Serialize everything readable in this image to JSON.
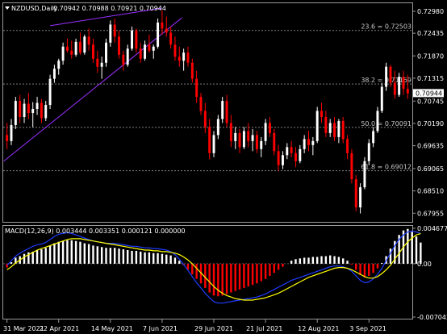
{
  "symbol_header": {
    "symbol": "NZDUSD,Daily",
    "ohlc": "0.70942 0.70988 0.70921 0.70944"
  },
  "macd_header": {
    "label": "MACD(12,26,9) 0.003444 0.003351 0.000121 0.000000"
  },
  "price_axis": {
    "ticks": [
      "0.72980",
      "0.72435",
      "0.71870",
      "0.71315",
      "0.70745",
      "0.70190",
      "0.69635",
      "0.69065",
      "0.68510",
      "0.67955"
    ],
    "current_price": "0.70944"
  },
  "macd_axis": {
    "ticks": [
      "0.004677",
      "0.00",
      "-0.007042"
    ]
  },
  "fib_levels": [
    {
      "label": "23.6 = 0.72503",
      "value": 0.72503
    },
    {
      "label": "38.2 = 0.71169",
      "value": 0.71169
    },
    {
      "label": "50.0 = 0.70091",
      "value": 0.70091
    },
    {
      "label": "61.8 = 0.69012",
      "value": 0.69012
    }
  ],
  "date_axis": {
    "labels": [
      "31 Mar 2021",
      "22 Apr 2021",
      "14 May 2021",
      "7 Jun 2021",
      "29 Jun 2021",
      "21 Jul 2021",
      "12 Aug 2021",
      "3 Sep 2021"
    ]
  },
  "colors": {
    "background": "#000000",
    "bull_candle": "#ffffff",
    "bear_candle": "#ff0000",
    "channel_line": "#9b30ff",
    "macd_bar_positive": "#ffffff",
    "macd_bar_negative": "#ff0000",
    "macd_line": "#1e3cff",
    "signal_line": "#ffff00",
    "grid": "#808080"
  },
  "chart_data": {
    "type": "candlestick",
    "timeframe": "Daily",
    "symbol": "NZDUSD",
    "ylim": [
      0.678,
      0.731
    ],
    "candles": [
      [
        0.699,
        0.702,
        0.6955,
        0.6975
      ],
      [
        0.6975,
        0.703,
        0.6965,
        0.7015
      ],
      [
        0.7015,
        0.7085,
        0.7005,
        0.7075
      ],
      [
        0.7075,
        0.709,
        0.702,
        0.7035
      ],
      [
        0.7035,
        0.708,
        0.702,
        0.7068
      ],
      [
        0.7068,
        0.7095,
        0.703,
        0.7045
      ],
      [
        0.7045,
        0.7072,
        0.701,
        0.7055
      ],
      [
        0.7055,
        0.7085,
        0.704,
        0.707
      ],
      [
        0.707,
        0.708,
        0.702,
        0.7032
      ],
      [
        0.7032,
        0.7075,
        0.7025,
        0.7065
      ],
      [
        0.7065,
        0.714,
        0.7055,
        0.713
      ],
      [
        0.713,
        0.7165,
        0.712,
        0.7155
      ],
      [
        0.7155,
        0.718,
        0.714,
        0.7175
      ],
      [
        0.7175,
        0.722,
        0.7165,
        0.721
      ],
      [
        0.721,
        0.723,
        0.7195,
        0.72
      ],
      [
        0.72,
        0.7225,
        0.718,
        0.719
      ],
      [
        0.719,
        0.723,
        0.7185,
        0.7222
      ],
      [
        0.7222,
        0.7245,
        0.719,
        0.7195
      ],
      [
        0.7195,
        0.724,
        0.719,
        0.7235
      ],
      [
        0.7235,
        0.7255,
        0.72,
        0.7215
      ],
      [
        0.7215,
        0.723,
        0.717,
        0.718
      ],
      [
        0.718,
        0.72,
        0.7145,
        0.716
      ],
      [
        0.716,
        0.7185,
        0.713,
        0.717
      ],
      [
        0.717,
        0.723,
        0.716,
        0.722
      ],
      [
        0.722,
        0.7275,
        0.721,
        0.7265
      ],
      [
        0.7265,
        0.728,
        0.722,
        0.7235
      ],
      [
        0.7235,
        0.725,
        0.718,
        0.719
      ],
      [
        0.719,
        0.72,
        0.715,
        0.7165
      ],
      [
        0.7165,
        0.7215,
        0.716,
        0.7205
      ],
      [
        0.7205,
        0.726,
        0.72,
        0.725
      ],
      [
        0.725,
        0.7255,
        0.7195,
        0.7205
      ],
      [
        0.7205,
        0.722,
        0.717,
        0.718
      ],
      [
        0.718,
        0.7225,
        0.7175,
        0.7215
      ],
      [
        0.7215,
        0.724,
        0.7195,
        0.72
      ],
      [
        0.72,
        0.7215,
        0.718,
        0.721
      ],
      [
        0.721,
        0.728,
        0.7205,
        0.727
      ],
      [
        0.727,
        0.73,
        0.724,
        0.7255
      ],
      [
        0.7255,
        0.7285,
        0.7235,
        0.7245
      ],
      [
        0.7245,
        0.726,
        0.7205,
        0.7215
      ],
      [
        0.7215,
        0.7235,
        0.7175,
        0.7185
      ],
      [
        0.7185,
        0.721,
        0.716,
        0.7175
      ],
      [
        0.7175,
        0.7205,
        0.715,
        0.7195
      ],
      [
        0.7195,
        0.721,
        0.716,
        0.717
      ],
      [
        0.717,
        0.718,
        0.712,
        0.713
      ],
      [
        0.713,
        0.715,
        0.707,
        0.7085
      ],
      [
        0.7085,
        0.7095,
        0.704,
        0.705
      ],
      [
        0.705,
        0.707,
        0.6995,
        0.701
      ],
      [
        0.701,
        0.703,
        0.693,
        0.6945
      ],
      [
        0.6945,
        0.7,
        0.6935,
        0.699
      ],
      [
        0.699,
        0.704,
        0.698,
        0.703
      ],
      [
        0.703,
        0.7085,
        0.702,
        0.7075
      ],
      [
        0.7075,
        0.709,
        0.701,
        0.702
      ],
      [
        0.702,
        0.704,
        0.696,
        0.6975
      ],
      [
        0.6975,
        0.701,
        0.6955,
        0.6995
      ],
      [
        0.6995,
        0.7005,
        0.6945,
        0.696
      ],
      [
        0.696,
        0.701,
        0.6955,
        0.7
      ],
      [
        0.7,
        0.702,
        0.696,
        0.6975
      ],
      [
        0.6975,
        0.7005,
        0.695,
        0.699
      ],
      [
        0.699,
        0.7,
        0.6945,
        0.6955
      ],
      [
        0.6955,
        0.6985,
        0.6935,
        0.6975
      ],
      [
        0.6975,
        0.703,
        0.6965,
        0.702
      ],
      [
        0.702,
        0.7035,
        0.6985,
        0.6995
      ],
      [
        0.6995,
        0.7005,
        0.694,
        0.695
      ],
      [
        0.695,
        0.6965,
        0.69,
        0.6915
      ],
      [
        0.6915,
        0.695,
        0.6905,
        0.694
      ],
      [
        0.694,
        0.697,
        0.693,
        0.696
      ],
      [
        0.696,
        0.6975,
        0.6935,
        0.6945
      ],
      [
        0.6945,
        0.696,
        0.691,
        0.6925
      ],
      [
        0.6925,
        0.6965,
        0.692,
        0.6955
      ],
      [
        0.6955,
        0.699,
        0.6945,
        0.698
      ],
      [
        0.698,
        0.7,
        0.695,
        0.6965
      ],
      [
        0.6965,
        0.6985,
        0.694,
        0.6975
      ],
      [
        0.6975,
        0.706,
        0.697,
        0.705
      ],
      [
        0.705,
        0.707,
        0.702,
        0.7035
      ],
      [
        0.7035,
        0.705,
        0.6985,
        0.6995
      ],
      [
        0.6995,
        0.703,
        0.6985,
        0.702
      ],
      [
        0.702,
        0.7035,
        0.6975,
        0.6985
      ],
      [
        0.6985,
        0.703,
        0.697,
        0.7025
      ],
      [
        0.7025,
        0.7035,
        0.697,
        0.698
      ],
      [
        0.698,
        0.699,
        0.693,
        0.6945
      ],
      [
        0.6945,
        0.6955,
        0.687,
        0.688
      ],
      [
        0.688,
        0.689,
        0.68,
        0.681
      ],
      [
        0.681,
        0.687,
        0.6795,
        0.686
      ],
      [
        0.686,
        0.6935,
        0.6855,
        0.6925
      ],
      [
        0.6925,
        0.698,
        0.6915,
        0.697
      ],
      [
        0.697,
        0.701,
        0.696,
        0.7
      ],
      [
        0.7,
        0.706,
        0.6995,
        0.705
      ],
      [
        0.705,
        0.712,
        0.7045,
        0.711
      ],
      [
        0.711,
        0.717,
        0.71,
        0.716
      ],
      [
        0.716,
        0.7165,
        0.711,
        0.712
      ],
      [
        0.712,
        0.715,
        0.708,
        0.709
      ],
      [
        0.709,
        0.7145,
        0.7085,
        0.7135
      ],
      [
        0.7135,
        0.715,
        0.709,
        0.7105
      ],
      [
        0.7105,
        0.714,
        0.708,
        0.7094
      ]
    ],
    "macd_ylim": [
      -0.007042,
      0.004677
    ],
    "macd_histogram": [
      -0.0005,
      0.0002,
      0.0008,
      0.001,
      0.0013,
      0.0015,
      0.0016,
      0.0018,
      0.0019,
      0.0021,
      0.0024,
      0.0027,
      0.0029,
      0.003,
      0.0031,
      0.0031,
      0.003,
      0.0029,
      0.0027,
      0.0026,
      0.0024,
      0.0023,
      0.0022,
      0.0021,
      0.0021,
      0.0021,
      0.002,
      0.0019,
      0.0018,
      0.0017,
      0.0017,
      0.0016,
      0.0015,
      0.0015,
      0.0014,
      0.0014,
      0.0013,
      0.0012,
      0.0011,
      0.0008,
      0.0004,
      -0.0002,
      -0.0008,
      -0.0014,
      -0.002,
      -0.0026,
      -0.0032,
      -0.0038,
      -0.0042,
      -0.0043,
      -0.0042,
      -0.004,
      -0.0038,
      -0.0036,
      -0.0034,
      -0.0032,
      -0.003,
      -0.0028,
      -0.0026,
      -0.0023,
      -0.002,
      -0.0016,
      -0.0012,
      -0.0008,
      -0.0004,
      0.0,
      0.0004,
      0.0006,
      0.0007,
      0.0008,
      0.0008,
      0.0009,
      0.0009,
      0.001,
      0.001,
      0.0011,
      0.001,
      0.0009,
      0.0007,
      0.0004,
      -0.0001,
      -0.0008,
      -0.0015,
      -0.0018,
      -0.0016,
      -0.0012,
      -0.0006,
      0.0001,
      0.001,
      0.002,
      0.003,
      0.0038,
      0.0044,
      0.0046,
      0.0042,
      0.0036,
      0.0028
    ],
    "macd_line": [
      -0.0002,
      0.0004,
      0.001,
      0.0014,
      0.0017,
      0.002,
      0.0023,
      0.0025,
      0.0026,
      0.0028,
      0.0032,
      0.0036,
      0.0039,
      0.004,
      0.0041,
      0.004,
      0.0038,
      0.0036,
      0.0034,
      0.0032,
      0.003,
      0.0029,
      0.0028,
      0.0027,
      0.0027,
      0.0027,
      0.0026,
      0.0025,
      0.0024,
      0.0023,
      0.0023,
      0.0022,
      0.0021,
      0.0021,
      0.002,
      0.002,
      0.0019,
      0.0018,
      0.0016,
      0.0012,
      0.0006,
      -0.0001,
      -0.0009,
      -0.0017,
      -0.0025,
      -0.0032,
      -0.0039,
      -0.0045,
      -0.005,
      -0.0052,
      -0.0052,
      -0.0051,
      -0.005,
      -0.0049,
      -0.0048,
      -0.0047,
      -0.0046,
      -0.0045,
      -0.0044,
      -0.0042,
      -0.004,
      -0.0037,
      -0.0034,
      -0.0031,
      -0.0028,
      -0.0025,
      -0.0022,
      -0.002,
      -0.0018,
      -0.0016,
      -0.0014,
      -0.0012,
      -0.001,
      -0.0008,
      -0.0006,
      -0.0004,
      -0.0003,
      -0.0003,
      -0.0004,
      -0.0006,
      -0.001,
      -0.0016,
      -0.0022,
      -0.0025,
      -0.0024,
      -0.002,
      -0.0014,
      -0.0006,
      0.0004,
      0.0014,
      0.0024,
      0.0032,
      0.0038,
      0.0042,
      0.0043,
      0.0042,
      0.004
    ],
    "signal_line": [
      -0.0008,
      -0.0004,
      0.0001,
      0.0005,
      0.0009,
      0.0012,
      0.0015,
      0.0018,
      0.002,
      0.0022,
      0.0024,
      0.0026,
      0.0028,
      0.003,
      0.0032,
      0.0033,
      0.0033,
      0.0033,
      0.0032,
      0.0031,
      0.003,
      0.0029,
      0.0028,
      0.0027,
      0.0026,
      0.0025,
      0.0024,
      0.0023,
      0.0022,
      0.0021,
      0.002,
      0.0019,
      0.0018,
      0.0018,
      0.0017,
      0.0017,
      0.0016,
      0.0016,
      0.0015,
      0.0014,
      0.0012,
      0.0009,
      0.0005,
      0.0,
      -0.0006,
      -0.0012,
      -0.0018,
      -0.0024,
      -0.003,
      -0.0035,
      -0.0039,
      -0.0042,
      -0.0044,
      -0.0046,
      -0.0047,
      -0.0048,
      -0.0048,
      -0.0048,
      -0.0047,
      -0.0046,
      -0.0045,
      -0.0043,
      -0.0041,
      -0.0039,
      -0.0036,
      -0.0033,
      -0.003,
      -0.0027,
      -0.0024,
      -0.0021,
      -0.0018,
      -0.0016,
      -0.0014,
      -0.0012,
      -0.001,
      -0.0008,
      -0.0006,
      -0.0005,
      -0.0005,
      -0.0006,
      -0.0008,
      -0.0011,
      -0.0014,
      -0.0017,
      -0.0019,
      -0.0019,
      -0.0017,
      -0.0013,
      -0.0008,
      -0.0002,
      0.0006,
      0.0014,
      0.0022,
      0.0029,
      0.0034,
      0.0038,
      0.004
    ]
  }
}
